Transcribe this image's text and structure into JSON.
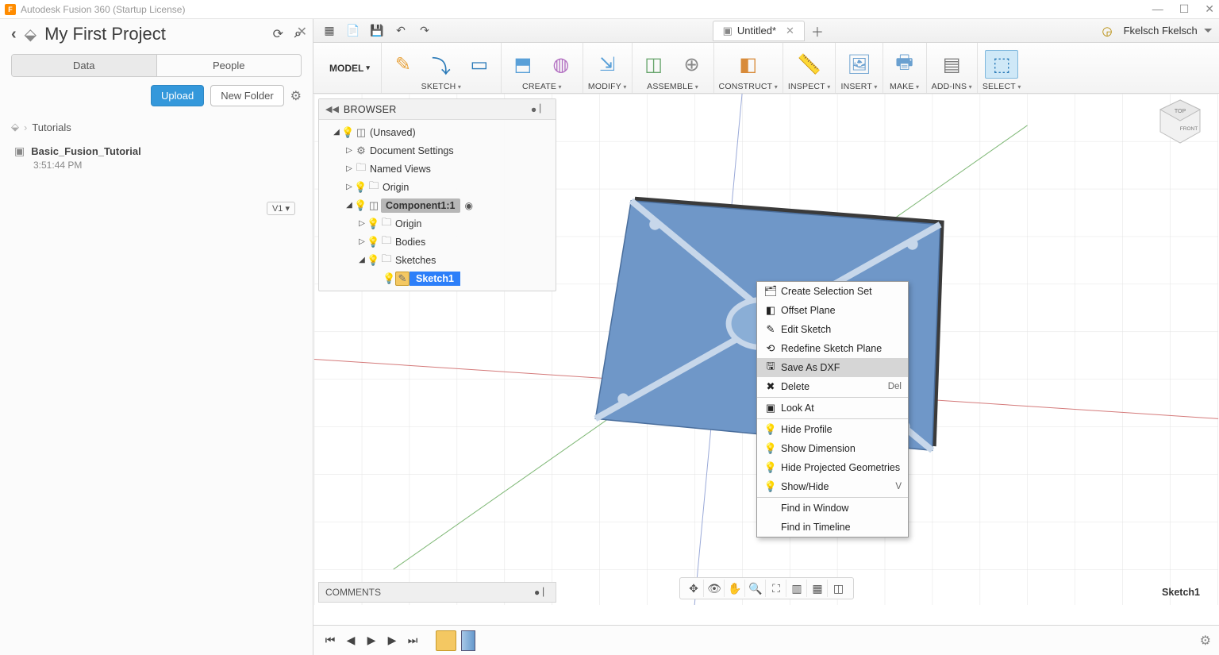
{
  "app": {
    "title": "Autodesk Fusion 360 (Startup License)",
    "icon_letter": "F"
  },
  "window_controls": {
    "min": "—",
    "max": "☐",
    "close": "✕"
  },
  "data_panel": {
    "title": "My First Project",
    "tabs": [
      "Data",
      "People"
    ],
    "upload": "Upload",
    "new_folder": "New Folder",
    "breadcrumb_root": "Tutorials",
    "file_name": "Basic_Fusion_Tutorial",
    "file_time": "3:51:44 PM",
    "version": "V1 ▾"
  },
  "qat": {
    "doc_title": "Untitled*",
    "user": "Fkelsch Fkelsch"
  },
  "ribbon": {
    "model": "MODEL",
    "groups": [
      {
        "label": "SKETCH",
        "icons": [
          "sketch-create-icon",
          "arc-icon",
          "rectangle-icon"
        ]
      },
      {
        "label": "CREATE",
        "icons": [
          "extrude-icon",
          "sphere-icon"
        ]
      },
      {
        "label": "MODIFY",
        "icons": [
          "press-pull-icon"
        ]
      },
      {
        "label": "ASSEMBLE",
        "icons": [
          "component-icon",
          "joint-icon"
        ]
      },
      {
        "label": "CONSTRUCT",
        "icons": [
          "plane-icon"
        ]
      },
      {
        "label": "INSPECT",
        "icons": [
          "measure-icon"
        ]
      },
      {
        "label": "INSERT",
        "icons": [
          "image-icon"
        ]
      },
      {
        "label": "MAKE",
        "icons": [
          "print-icon"
        ]
      },
      {
        "label": "ADD-INS",
        "icons": [
          "script-icon"
        ]
      },
      {
        "label": "SELECT",
        "icons": [
          "select-icon"
        ],
        "active": true
      }
    ]
  },
  "browser": {
    "header": "BROWSER",
    "nodes": {
      "root": "(Unsaved)",
      "doc_settings": "Document Settings",
      "named_views": "Named Views",
      "origin": "Origin",
      "component": "Component1:1",
      "c_origin": "Origin",
      "c_bodies": "Bodies",
      "c_sketches": "Sketches",
      "sketch1": "Sketch1"
    }
  },
  "context_menu": [
    {
      "icon": "selset-icon",
      "label": "Create Selection Set"
    },
    {
      "icon": "offset-plane-icon",
      "label": "Offset Plane"
    },
    {
      "icon": "edit-sketch-icon",
      "label": "Edit Sketch"
    },
    {
      "icon": "redefine-icon",
      "label": "Redefine Sketch Plane"
    },
    {
      "icon": "dxf-icon",
      "label": "Save As DXF",
      "hover": true
    },
    {
      "icon": "delete-icon",
      "label": "Delete",
      "shortcut": "Del"
    },
    {
      "sep": true
    },
    {
      "icon": "lookat-icon",
      "label": "Look At"
    },
    {
      "sep": true
    },
    {
      "icon": "bulb-on-icon",
      "label": "Hide Profile"
    },
    {
      "icon": "bulb-on-icon",
      "label": "Show Dimension"
    },
    {
      "icon": "bulb-on-icon",
      "label": "Hide Projected Geometries"
    },
    {
      "icon": "bulb-off-icon",
      "label": "Show/Hide",
      "shortcut": "V"
    },
    {
      "sep": true
    },
    {
      "label": "Find in Window"
    },
    {
      "label": "Find in Timeline"
    }
  ],
  "comments": "COMMENTS",
  "status_sketch": "Sketch1",
  "viewcube": {
    "top": "TOP",
    "front": "FRONT"
  }
}
